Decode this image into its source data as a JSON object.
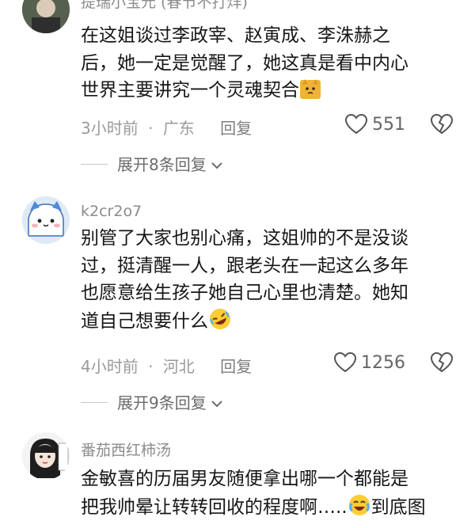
{
  "comments": [
    {
      "username": "提瑞小宝元 (春节不打烊)",
      "lines": [
        "在这姐谈过李政宰、赵寅成、李洙赫之",
        "后，她一定是觉醒了，她这真是看中内心",
        "世界主要讲究一个灵魂契合"
      ],
      "emoji_name": "cat-shrug-emoji",
      "time": "3小时前",
      "dot": "·",
      "location": "广东",
      "reply": "回复",
      "likes": "551",
      "expand": "展开8条回复"
    },
    {
      "username": "k2cr2o7",
      "lines": [
        "别管了大家也别心痛，这姐帅的不是没谈",
        "过，挺清醒一人，跟老头在一起这么多年",
        "也愿意给生孩子她自己心里也清楚。她知",
        "道自己想要什么"
      ],
      "emoji_name": "rofl-emoji",
      "time": "4小时前",
      "dot": "·",
      "location": "河北",
      "reply": "回复",
      "likes": "1256",
      "expand": "展开9条回复"
    },
    {
      "username": "番茄西红柿汤",
      "lines": [
        "金敏喜的历届男友随便拿出哪一个都能是",
        "把我帅晕让转转回收的程度啊…..",
        "到底图"
      ],
      "emoji_name": "crying-laughing-emoji"
    }
  ],
  "colors": {
    "text": "#161616",
    "meta": "#9a9a9a",
    "username": "#8c8c8c",
    "divider": "#c8c8c8"
  }
}
